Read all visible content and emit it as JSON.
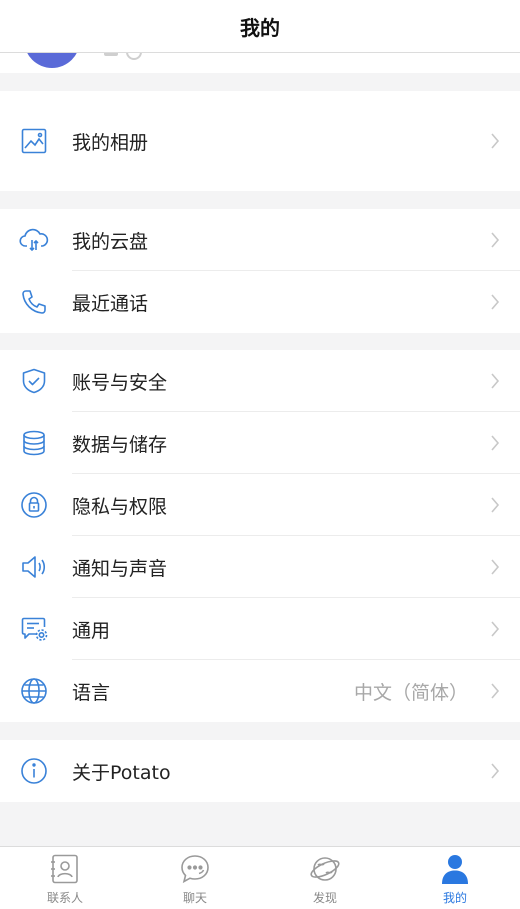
{
  "header": {
    "title": "我的"
  },
  "colors": {
    "accent": "#2a78e0",
    "icon_blue": "#3a82d8",
    "chevron": "#c8c8c8"
  },
  "groups": [
    {
      "items": [
        {
          "label": "我的相册",
          "icon": "photo-album-icon"
        }
      ]
    },
    {
      "items": [
        {
          "label": "我的云盘",
          "icon": "cloud-drive-icon"
        },
        {
          "label": "最近通话",
          "icon": "phone-icon"
        }
      ]
    },
    {
      "items": [
        {
          "label": "账号与安全",
          "icon": "shield-check-icon"
        },
        {
          "label": "数据与储存",
          "icon": "database-icon"
        },
        {
          "label": "隐私与权限",
          "icon": "lock-icon"
        },
        {
          "label": "通知与声音",
          "icon": "speaker-icon"
        },
        {
          "label": "通用",
          "icon": "general-settings-icon"
        },
        {
          "label": "语言",
          "icon": "globe-icon",
          "value": "中文（简体）"
        }
      ]
    },
    {
      "items": [
        {
          "label": "关于Potato",
          "icon": "info-icon"
        }
      ]
    }
  ],
  "tabbar": {
    "tabs": [
      {
        "label": "联系人",
        "icon": "contacts-icon",
        "active": false
      },
      {
        "label": "聊天",
        "icon": "chat-icon",
        "active": false
      },
      {
        "label": "发现",
        "icon": "discover-icon",
        "active": false
      },
      {
        "label": "我的",
        "icon": "profile-icon",
        "active": true
      }
    ]
  }
}
